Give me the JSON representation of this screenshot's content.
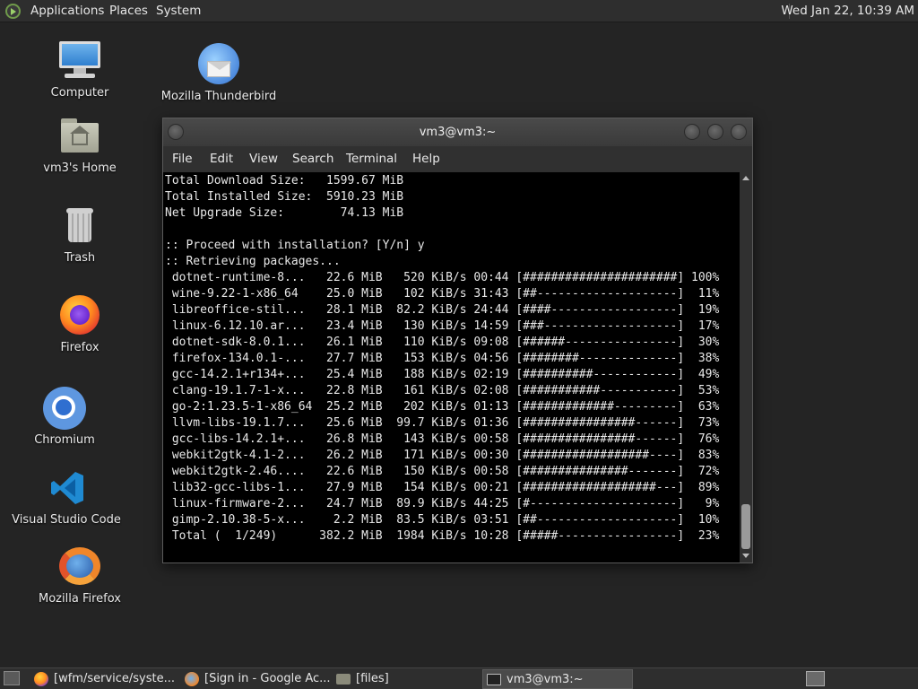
{
  "top_panel": {
    "menus": [
      "Applications",
      "Places",
      "System"
    ],
    "clock": "Wed Jan 22, 10:39 AM"
  },
  "desktop_icons": [
    {
      "label": "Computer",
      "icon": "computer-icon"
    },
    {
      "label": "vm3's Home",
      "icon": "home-folder-icon"
    },
    {
      "label": "Trash",
      "icon": "trash-icon"
    },
    {
      "label": "Firefox",
      "icon": "firefox-icon"
    },
    {
      "label": "Chromium",
      "icon": "chromium-icon"
    },
    {
      "label": "Visual Studio Code",
      "icon": "vscode-icon"
    },
    {
      "label": "Mozilla Firefox",
      "icon": "mozilla-firefox-icon"
    },
    {
      "label": "Mozilla Thunderbird",
      "icon": "thunderbird-icon"
    }
  ],
  "terminal": {
    "title": "vm3@vm3:~",
    "menu": [
      "File",
      "Edit",
      "View",
      "Search",
      "Terminal",
      "Help"
    ],
    "summary": [
      "Total Download Size:   1599.67 MiB",
      "Total Installed Size:  5910.23 MiB",
      "Net Upgrade Size:        74.13 MiB",
      "",
      ":: Proceed with installation? [Y/n] y",
      ":: Retrieving packages..."
    ],
    "packages": [
      {
        "name": "dotnet-runtime-8...",
        "size": "22.6 MiB",
        "speed": "520 KiB/s",
        "eta": "00:44",
        "bar": "[######################]",
        "percent": "100%"
      },
      {
        "name": "wine-9.22-1-x86_64",
        "size": "25.0 MiB",
        "speed": "102 KiB/s",
        "eta": "31:43",
        "bar": "[##--------------------]",
        "percent": "11%"
      },
      {
        "name": "libreoffice-stil...",
        "size": "28.1 MiB",
        "speed": "82.2 KiB/s",
        "eta": "24:44",
        "bar": "[####------------------]",
        "percent": "19%"
      },
      {
        "name": "linux-6.12.10.ar...",
        "size": "23.4 MiB",
        "speed": "130 KiB/s",
        "eta": "14:59",
        "bar": "[###-------------------]",
        "percent": "17%"
      },
      {
        "name": "dotnet-sdk-8.0.1...",
        "size": "26.1 MiB",
        "speed": "110 KiB/s",
        "eta": "09:08",
        "bar": "[######----------------]",
        "percent": "30%"
      },
      {
        "name": "firefox-134.0.1-...",
        "size": "27.7 MiB",
        "speed": "153 KiB/s",
        "eta": "04:56",
        "bar": "[########--------------]",
        "percent": "38%"
      },
      {
        "name": "gcc-14.2.1+r134+...",
        "size": "25.4 MiB",
        "speed": "188 KiB/s",
        "eta": "02:19",
        "bar": "[##########------------]",
        "percent": "49%"
      },
      {
        "name": "clang-19.1.7-1-x...",
        "size": "22.8 MiB",
        "speed": "161 KiB/s",
        "eta": "02:08",
        "bar": "[###########-----------]",
        "percent": "53%"
      },
      {
        "name": "go-2:1.23.5-1-x86_64",
        "size": "25.2 MiB",
        "speed": "202 KiB/s",
        "eta": "01:13",
        "bar": "[#############---------]",
        "percent": "63%"
      },
      {
        "name": "llvm-libs-19.1.7...",
        "size": "25.6 MiB",
        "speed": "99.7 KiB/s",
        "eta": "01:36",
        "bar": "[################------]",
        "percent": "73%"
      },
      {
        "name": "gcc-libs-14.2.1+...",
        "size": "26.8 MiB",
        "speed": "143 KiB/s",
        "eta": "00:58",
        "bar": "[################------]",
        "percent": "76%"
      },
      {
        "name": "webkit2gtk-4.1-2...",
        "size": "26.2 MiB",
        "speed": "171 KiB/s",
        "eta": "00:30",
        "bar": "[##################----]",
        "percent": "83%"
      },
      {
        "name": "webkit2gtk-2.46....",
        "size": "22.6 MiB",
        "speed": "150 KiB/s",
        "eta": "00:58",
        "bar": "[###############-------]",
        "percent": "72%"
      },
      {
        "name": "lib32-gcc-libs-1...",
        "size": "27.9 MiB",
        "speed": "154 KiB/s",
        "eta": "00:21",
        "bar": "[###################---]",
        "percent": "89%"
      },
      {
        "name": "linux-firmware-2...",
        "size": "24.7 MiB",
        "speed": "89.9 KiB/s",
        "eta": "44:25",
        "bar": "[#---------------------]",
        "percent": "9%"
      },
      {
        "name": "gimp-2.10.38-5-x...",
        "size": "2.2 MiB",
        "speed": "83.5 KiB/s",
        "eta": "03:51",
        "bar": "[##--------------------]",
        "percent": "10%"
      }
    ],
    "total": {
      "name": "Total (  1/249)",
      "size": "382.2 MiB",
      "speed": "1984 KiB/s",
      "eta": "10:28",
      "bar": "[#####-----------------]",
      "percent": "23%"
    }
  },
  "taskbar": [
    {
      "label": "[wfm/service/syste...",
      "icon": "firefox-icon",
      "active": false
    },
    {
      "label": "[Sign in - Google Ac...",
      "icon": "mozilla-firefox-icon",
      "active": false
    },
    {
      "label": "[files]",
      "icon": "folder-icon",
      "active": false
    },
    {
      "label": "vm3@vm3:~",
      "icon": "terminal-icon",
      "active": true
    }
  ]
}
